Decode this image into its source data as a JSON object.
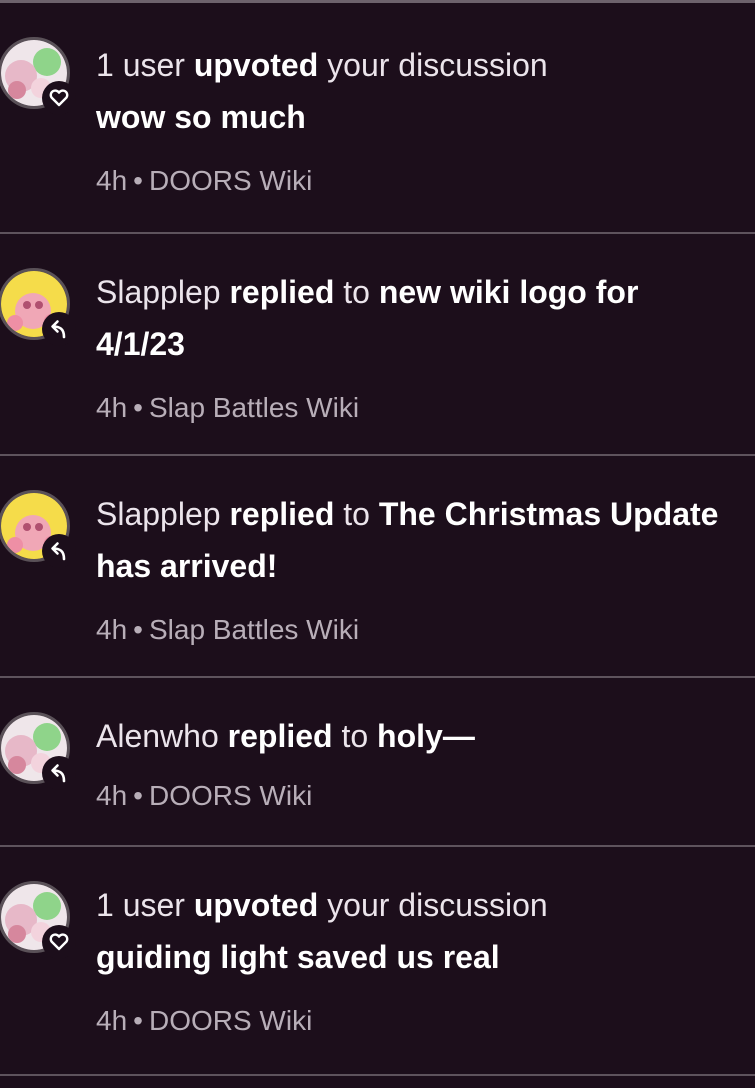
{
  "notifications": [
    {
      "actor": "1 user",
      "action": "upvoted",
      "connector": "your discussion",
      "title": "wow so much",
      "time": "4h",
      "separator": "•",
      "wiki": "DOORS Wiki",
      "badge_icon": "heart-icon",
      "avatar": "pink-green-avatar"
    },
    {
      "actor": "Slapplep",
      "action": "replied",
      "connector": "to",
      "title": "new wiki logo for 4/1/23",
      "time": "4h",
      "separator": "•",
      "wiki": "Slap Battles Wiki",
      "badge_icon": "reply-arrow-icon",
      "avatar": "yellow-pink-avatar"
    },
    {
      "actor": "Slapplep",
      "action": "replied",
      "connector": "to",
      "title": "The Christmas Update has arrived!",
      "time": "4h",
      "separator": "•",
      "wiki": "Slap Battles Wiki",
      "badge_icon": "reply-arrow-icon",
      "avatar": "yellow-pink-avatar"
    },
    {
      "actor": "Alenwho",
      "action": "replied",
      "connector": "to",
      "title": "holy—",
      "time": "4h",
      "separator": "•",
      "wiki": "DOORS Wiki",
      "badge_icon": "reply-arrow-icon",
      "avatar": "pink-green-avatar"
    },
    {
      "actor": "1 user",
      "action": "upvoted",
      "connector": "your discussion",
      "title": "guiding light saved us real",
      "time": "4h",
      "separator": "•",
      "wiki": "DOORS Wiki",
      "badge_icon": "heart-icon",
      "avatar": "pink-green-avatar"
    }
  ],
  "colors": {
    "background": "#1c0e1b",
    "divider": "#5e535d",
    "meta_text": "#b8aeb8"
  }
}
